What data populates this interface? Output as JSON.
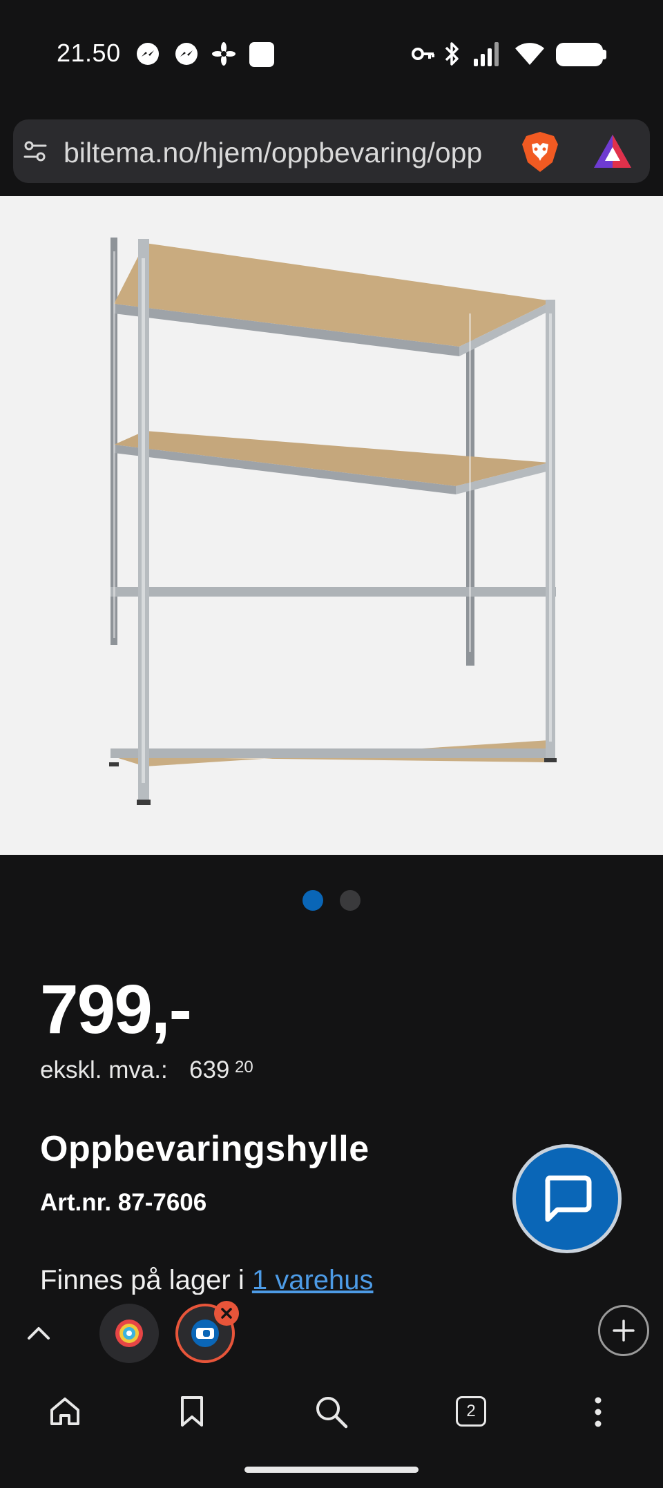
{
  "status_bar": {
    "time": "21.50",
    "icons": [
      "messenger-icon",
      "messenger-icon",
      "pinwheel-icon",
      "app-square-icon",
      "key-icon",
      "bluetooth-icon",
      "signal-icon",
      "wifi-icon",
      "battery-icon"
    ]
  },
  "browser": {
    "url": "biltema.no/hjem/oppbevaring/opp",
    "icons": [
      "site-settings-icon",
      "brave-shields-icon",
      "brave-rewards-icon"
    ]
  },
  "gallery": {
    "image": "storage-shelf-image",
    "active_index": 0,
    "count": 2
  },
  "product": {
    "price": "799,-",
    "vat_label": "ekskl. mva.:",
    "vat_main": "639",
    "vat_decimals": "20",
    "title": "Oppbevaringshylle",
    "art_nr": "Art.nr. 87-7606",
    "stock_prefix": "Finnes på lager i ",
    "stock_link": "1 varehus"
  },
  "tab_strip": {
    "tabs": [
      "circle-logo-tab",
      "biltema-tab"
    ],
    "active_tab": 1
  },
  "bottom_nav": {
    "tab_count": "2",
    "items": [
      "home-icon",
      "bookmark-icon",
      "search-icon",
      "tabs-icon",
      "more-icon"
    ]
  },
  "colors": {
    "background": "#131314",
    "accent_blue": "#0a66b7",
    "link_blue": "#4d9be6",
    "close_badge": "#e8553a"
  }
}
